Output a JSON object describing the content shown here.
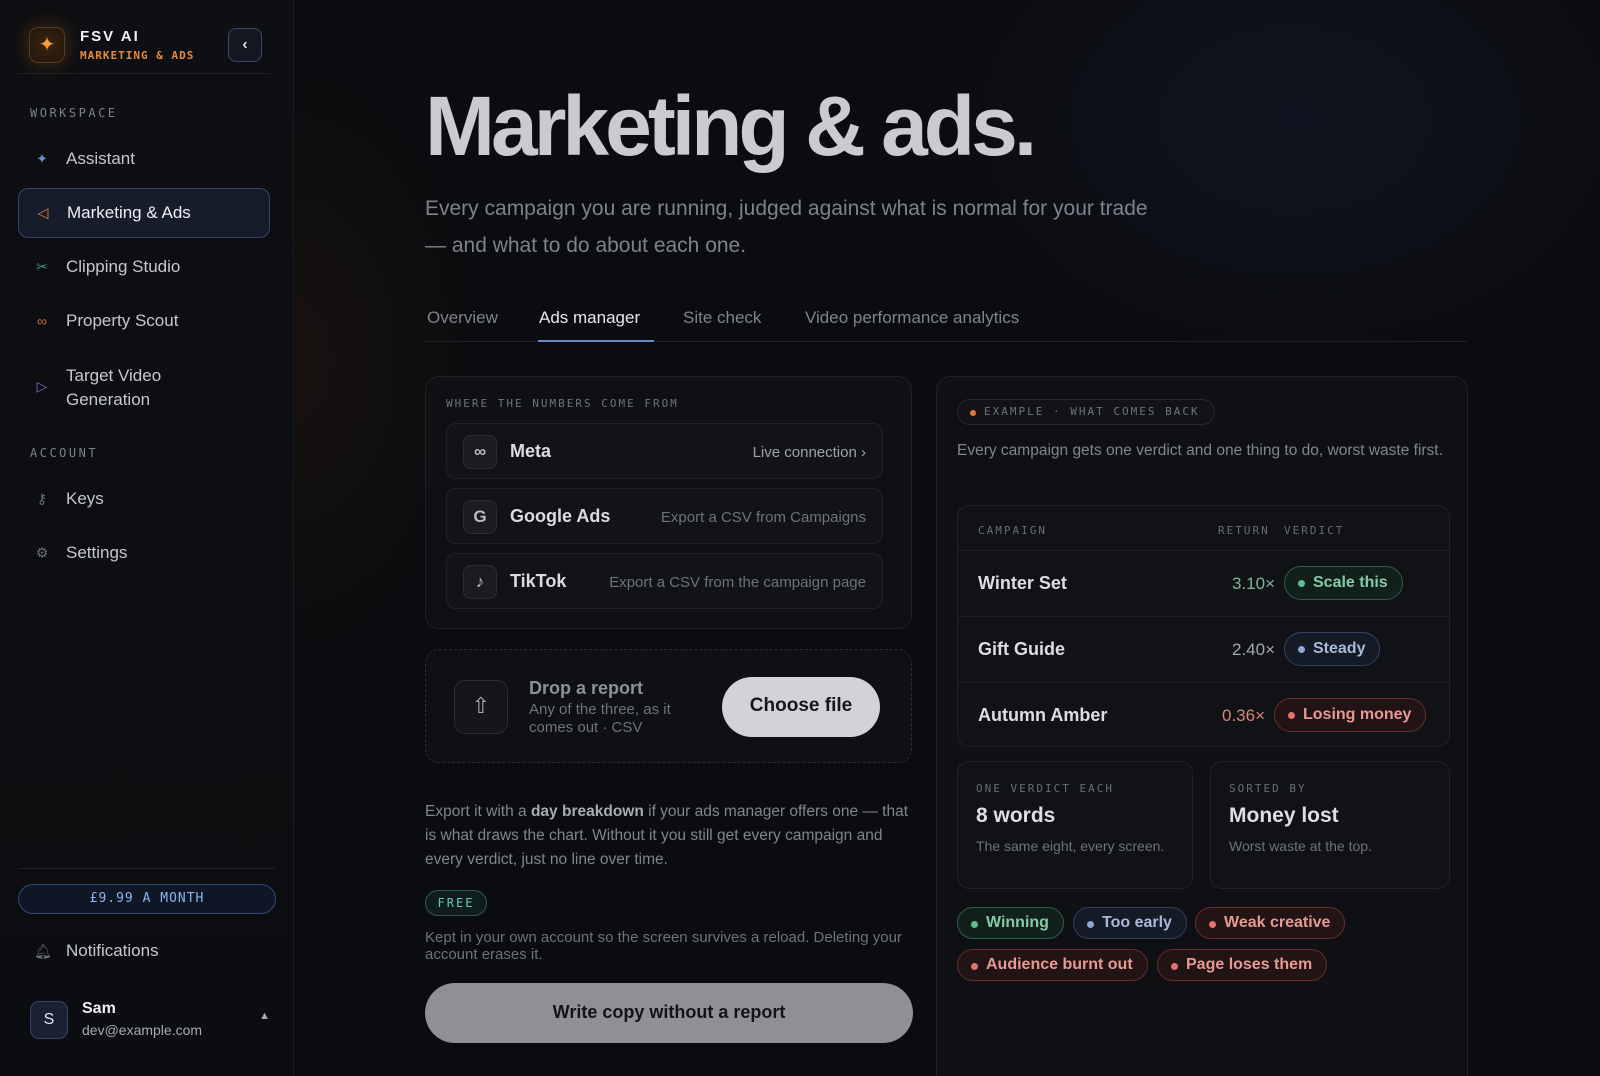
{
  "sidebar": {
    "brand_name": "FSV AI",
    "brand_sub": "MARKETING & ADS",
    "workspace_label": "WORKSPACE",
    "account_label": "ACCOUNT",
    "workspace_items": [
      {
        "label": "Assistant",
        "icon": "sparkle-icon"
      },
      {
        "label": "Marketing & Ads",
        "icon": "megaphone-icon",
        "active": true
      },
      {
        "label": "Clipping Studio",
        "icon": "scissors-icon"
      },
      {
        "label": "Property Scout",
        "icon": "binoculars-icon"
      },
      {
        "label": "Target Video Generation",
        "icon": "play-icon"
      }
    ],
    "account_items": [
      {
        "label": "Keys",
        "icon": "key-icon"
      },
      {
        "label": "Settings",
        "icon": "gear-icon"
      }
    ],
    "price": "£9.99 A MONTH",
    "notifications": "Notifications",
    "user": {
      "initial": "S",
      "name": "Sam",
      "email": "dev@example.com"
    }
  },
  "main": {
    "title": "Marketing & ads.",
    "subtitle": "Every campaign you are running, judged against what is normal for your trade — and what to do about each one.",
    "tabs": [
      {
        "label": "Overview"
      },
      {
        "label": "Ads manager",
        "active": true
      },
      {
        "label": "Site check"
      },
      {
        "label": "Video performance analytics"
      }
    ],
    "sources": {
      "label": "WHERE THE NUMBERS COME FROM",
      "items": [
        {
          "name": "Meta",
          "note": "Live connection",
          "icon": "meta-icon"
        },
        {
          "name": "Google Ads",
          "note": "Export a CSV from Campaigns",
          "icon": "google-icon"
        },
        {
          "name": "TikTok",
          "note": "Export a CSV from the campaign page",
          "icon": "tiktok-icon"
        }
      ]
    },
    "drop": {
      "title": "Drop a report",
      "sub": "Any of the three, as it comes out · CSV",
      "button": "Choose file"
    },
    "export_pre": "Export it with a ",
    "export_bold": "day breakdown",
    "export_post": " if your ads manager offers one — that is what draws the chart. Without it you still get every campaign and every verdict, just no line over time.",
    "free_badge": "FREE",
    "free_text": "Kept in your own account so the screen survives a reload. Deleting your account erases it.",
    "write_button": "Write copy without a report"
  },
  "example": {
    "pill": "EXAMPLE · WHAT COMES BACK",
    "desc": "Every campaign gets one verdict and one thing to do, worst waste first.",
    "headers": {
      "campaign": "CAMPAIGN",
      "return": "RETURN",
      "verdict": "VERDICT"
    },
    "rows": [
      {
        "campaign": "Winter Set",
        "return": "3.10×",
        "verdict": "Scale this",
        "tone": "green"
      },
      {
        "campaign": "Gift Guide",
        "return": "2.40×",
        "verdict": "Steady",
        "tone": "blue"
      },
      {
        "campaign": "Autumn Amber",
        "return": "0.36×",
        "verdict": "Losing money",
        "tone": "red"
      }
    ],
    "stats": [
      {
        "label": "ONE VERDICT EACH",
        "value": "8 words",
        "note": "The same eight, every screen."
      },
      {
        "label": "SORTED BY",
        "value": "Money lost",
        "note": "Worst waste at the top."
      }
    ],
    "tags": [
      {
        "label": "Winning",
        "tone": "green"
      },
      {
        "label": "Too early",
        "tone": "blue"
      },
      {
        "label": "Weak creative",
        "tone": "red"
      },
      {
        "label": "Audience burnt out",
        "tone": "red"
      },
      {
        "label": "Page loses them",
        "tone": "red"
      }
    ]
  },
  "colors": {
    "accent_orange": "#e88a3a",
    "accent_blue": "#6b86c4",
    "green": "#5ec090",
    "red": "#e2736a"
  }
}
